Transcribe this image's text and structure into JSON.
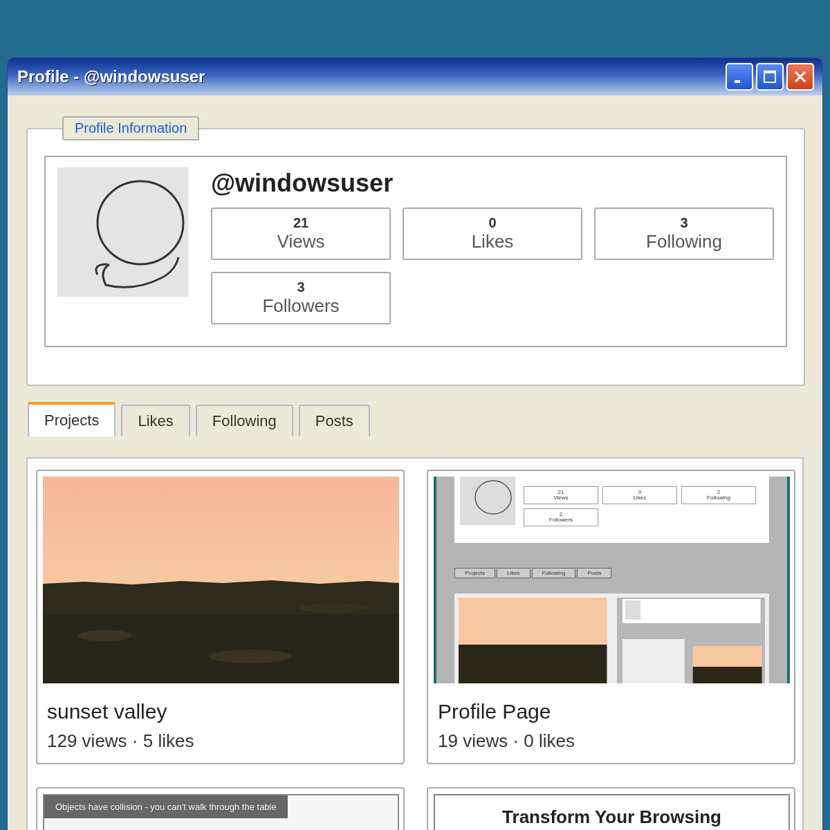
{
  "window": {
    "title": "Profile - @windowsuser"
  },
  "profile": {
    "legend": "Profile Information",
    "username": "@windowsuser",
    "stats": [
      {
        "value": "21",
        "label": "Views"
      },
      {
        "value": "0",
        "label": "Likes"
      },
      {
        "value": "3",
        "label": "Following"
      },
      {
        "value": "3",
        "label": "Followers"
      }
    ]
  },
  "tabs": [
    {
      "label": "Projects",
      "selected": true
    },
    {
      "label": "Likes",
      "selected": false
    },
    {
      "label": "Following",
      "selected": false
    },
    {
      "label": "Posts",
      "selected": false
    }
  ],
  "projects": [
    {
      "kind": "picture",
      "title": "sunset valley",
      "meta": "129 views · 5 likes"
    },
    {
      "kind": "screenshot",
      "title": "Profile Page",
      "meta": "19 views · 0 likes",
      "preview": {
        "stats": [
          {
            "value": "21",
            "label": "Views"
          },
          {
            "value": "0",
            "label": "Likes"
          },
          {
            "value": "2",
            "label": "Following"
          },
          {
            "value": "2",
            "label": "Followers"
          }
        ],
        "tabs": [
          "Projects",
          "Likes",
          "Following",
          "Posts"
        ]
      }
    },
    {
      "kind": "caption",
      "caption": "Objects have collision - you can't walk through the table"
    },
    {
      "kind": "heading",
      "heading": "Transform Your Browsing"
    }
  ]
}
